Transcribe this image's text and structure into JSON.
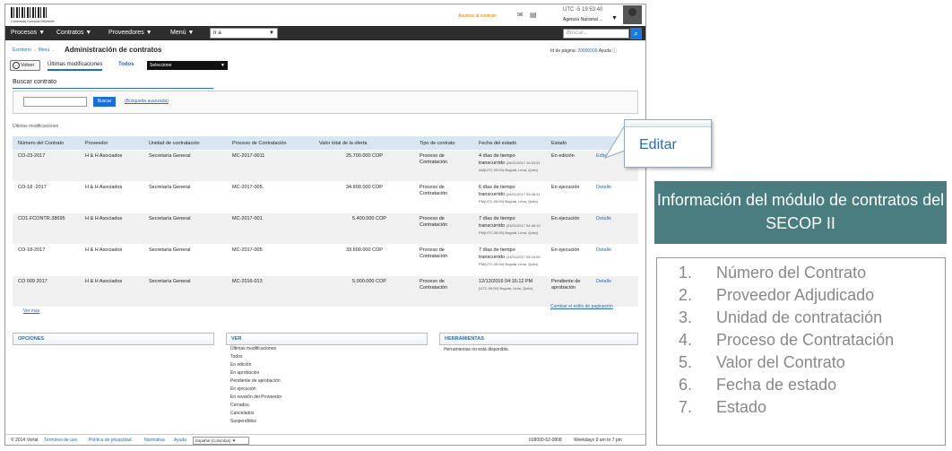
{
  "header": {
    "logo_text": "Colombia Compra Eficiente",
    "alert_link": "Asuntos al contrato",
    "utc": "UTC -5 19:53:40",
    "agency": "Agencia Nacional ..."
  },
  "nav": {
    "items": [
      "Procesos ▼",
      "Contratos ▼",
      "Proveedores ▼",
      "Menú ▼"
    ],
    "go_to": "Ir a",
    "search_placeholder": "Buscar..."
  },
  "page": {
    "breadcrumb": "Escritorio → Menú →",
    "title": "Administración de contratos",
    "page_id_label": "Id de página:",
    "page_id": "20000000",
    "help": "Ayuda"
  },
  "tabs": {
    "back": "Volver",
    "active": "Últimas modificaciones",
    "todos": "Todos",
    "select": "Seleccione"
  },
  "search": {
    "title": "Buscar contrato",
    "button": "Buscar",
    "advanced": "(Búsqueda avanzada)"
  },
  "table": {
    "caption": "Últimas modificaciones",
    "headers": [
      "Número del Contrato",
      "Proveedor",
      "Unidad de contratación",
      "Proceso de Contratación",
      "Valor total de la oferta",
      "Tipo de contrato",
      "Fecha del estado",
      "Estado"
    ],
    "rows": [
      {
        "numero": "CO-23-2017",
        "proveedor": "H & H Asociados",
        "unidad": "Secretaría General",
        "proceso": "MC-2017-0011",
        "valor": "25.700.000 COP",
        "tipo": "Proceso de Contratación",
        "fecha_main": "4 días de tiempo transcurrido",
        "fecha_detail": "(26/01/2017 10:33:31 AM(UTC-05:00) Bogotá, Lima, Quito)",
        "estado": "En edición",
        "accion": "Editar"
      },
      {
        "numero": "CO-18 -2017",
        "proveedor": "H & H Asociados",
        "unidad": "Secretaría General",
        "proceso": "MC-2017-005.",
        "valor": "34.800.000 COP",
        "tipo": "Proceso de Contratación",
        "fecha_main": "6 días de tiempo transcurrido",
        "fecha_detail": "(24/01/2017 09:46:31 PM(UTC-05:00) Bogotá, Lima, Quito)",
        "estado": "En ejecución",
        "accion": "Detalle"
      },
      {
        "numero": "CO1.FCONTR.38695",
        "proveedor": "H & H Asociados",
        "unidad": "Secretaría General",
        "proceso": "MC-2017-001",
        "valor": "5.400.000 COP",
        "tipo": "Proceso de Contratación",
        "fecha_main": "7 días de tiempo transcurrido",
        "fecha_detail": "(23/01/2017 04:46:10 PM(UTC-05:00) Bogotá, Lima, Quito)",
        "estado": "En ejecución",
        "accion": "Detalle"
      },
      {
        "numero": "CO-18-2017",
        "proveedor": "H & H Asociados",
        "unidad": "Secretaría General",
        "proceso": "MC-2017-005",
        "valor": "33.600.000 COP",
        "tipo": "Proceso de Contratación",
        "fecha_main": "7 días de tiempo transcurrido",
        "fecha_detail": "(23/01/2017 05:16:50 PM(UTC-05:00) Bogotá, Lima, Quito)",
        "estado": "En ejecución",
        "accion": "Detalle"
      },
      {
        "numero": "CO 009 2017",
        "proveedor": "H & H Asociados",
        "unidad": "Secretaría General",
        "proceso": "MC-2016-013",
        "valor": "5.000.000 COP",
        "tipo": "Proceso de Contratación",
        "fecha_main": "12/12/2016 04:16:12 PM",
        "fecha_detail": "(UTC-05:00) Bogotá, Lima, Quito)",
        "estado": "Pendiente de aprobación",
        "accion": "Detalle"
      }
    ],
    "more": "Ver más",
    "pagination_style": "Cambiar el estilo de paginación"
  },
  "panels": {
    "opciones": "OPCIONES",
    "ver": "VER",
    "herramientas": "HERRAMIENTAS",
    "ver_items": [
      "Últimas modificaciones",
      "Todos",
      "En edición",
      "En aprobación",
      "Pendiente de aprobación",
      "En ejecución",
      "En revisión del Proveedor",
      "Cerrados",
      "Cancelados",
      "Suspendidos"
    ],
    "tools_text": "Herramientas no está disponible."
  },
  "footer": {
    "copyright": "© 2014 Vortal",
    "terms": "Términos de uso",
    "privacy": "Política de privacidad",
    "normativa": "Normativa",
    "help": "Ayuda",
    "language": "Español (Colombia)",
    "phone": "018000-52-0808",
    "hours": "Weekdays 9 am to 7 pm"
  },
  "callout": {
    "label": "Editar"
  },
  "info": {
    "title": "Información del módulo de contratos del SECOP II",
    "items": [
      {
        "n": "1.",
        "label": "Número del Contrato"
      },
      {
        "n": "2.",
        "label": "Proveedor Adjudicado"
      },
      {
        "n": "3.",
        "label": "Unidad de contratación"
      },
      {
        "n": "4.",
        "label": "Proceso de Contratación"
      },
      {
        "n": "5.",
        "label": "Valor del Contrato"
      },
      {
        "n": "6.",
        "label": "Fecha de estado"
      },
      {
        "n": "7.",
        "label": "Estado"
      }
    ]
  }
}
